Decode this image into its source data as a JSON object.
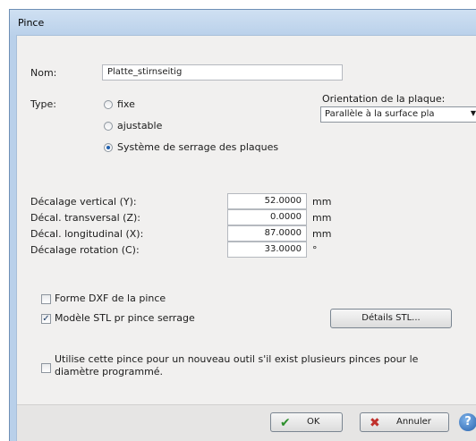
{
  "window": {
    "title": "Pince"
  },
  "form": {
    "name_label": "Nom:",
    "name_value": "Platte_stirnseitig",
    "type_label": "Type:",
    "type_options": [
      {
        "label": "fixe",
        "checked": false
      },
      {
        "label": "ajustable",
        "checked": false
      },
      {
        "label": "Système de serrage des plaques",
        "checked": true
      }
    ],
    "orientation_label": "Orientation de la plaque:",
    "orientation_value": "Parallèle à la surface pla",
    "offsets": [
      {
        "label": "Décalage vertical (Y):",
        "value": "52.0000",
        "unit": "mm"
      },
      {
        "label": "Décal. transversal (Z):",
        "value": "0.0000",
        "unit": "mm"
      },
      {
        "label": "Décal. longitudinal (X):",
        "value": "87.0000",
        "unit": "mm"
      },
      {
        "label": "Décalage rotation (C):",
        "value": "33.0000",
        "unit": "°"
      }
    ],
    "dxf_checkbox": {
      "label": "Forme DXF de la pince",
      "checked": false
    },
    "stl_checkbox": {
      "label": "Modèle STL pr pince serrage",
      "checked": true
    },
    "stl_details_button": "Détails STL...",
    "multi_clamp_checkbox": {
      "line1": "Utilise cette pince pour un nouveau outil s'il exist plusieurs pinces pour le",
      "line2": "diamètre programmé.",
      "checked": false
    }
  },
  "footer": {
    "ok_label": "OK",
    "cancel_label": "Annuler",
    "help_glyph": "?"
  },
  "colors": {
    "title_gradient_top": "#cfe0f2",
    "client_bg": "#f1f0ef",
    "ok_icon": "#2c8f2c",
    "cancel_icon": "#c0302c",
    "help_icon": "#2762ad"
  },
  "icons": {
    "ok": "checkmark-icon",
    "cancel": "cross-icon",
    "help": "help-icon",
    "dropdown": "chevron-down-icon"
  }
}
